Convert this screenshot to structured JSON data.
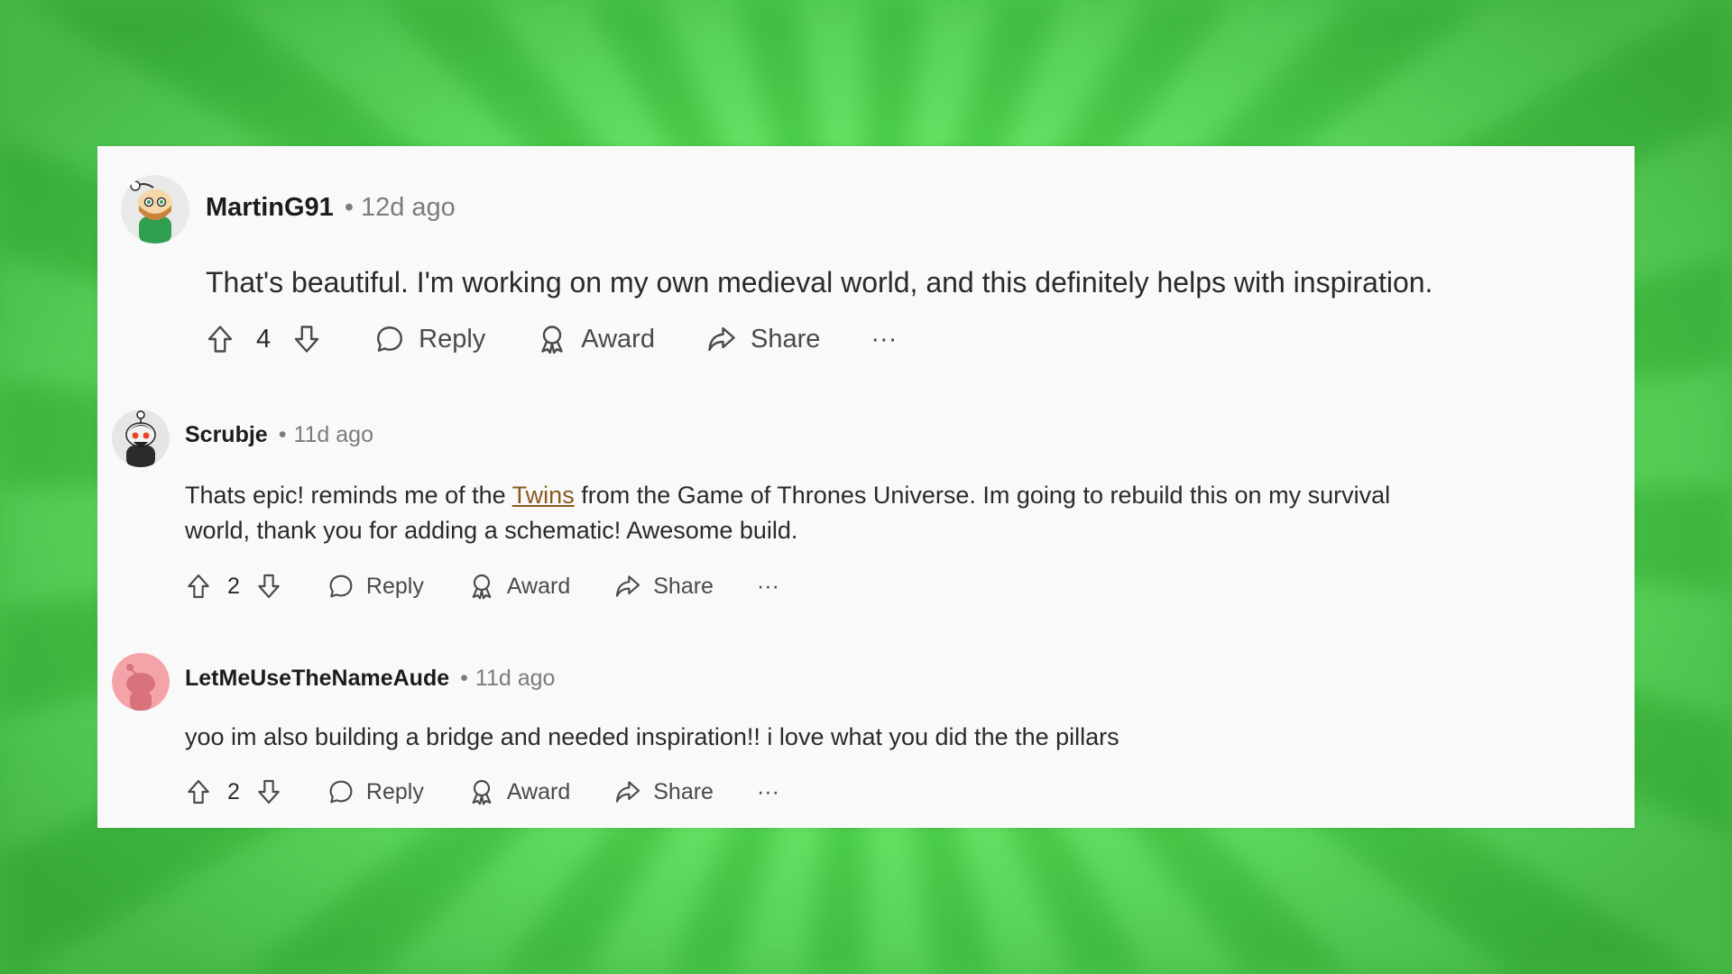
{
  "comments": [
    {
      "username": "MartinG91",
      "separator": "•",
      "time": "12d ago",
      "avatar_icon": "snoo-avatar-green",
      "body": "That's beautiful. I'm working on my own medieval world, and this definitely helps with inspiration.",
      "votes": "4",
      "actions": {
        "reply": "Reply",
        "award": "Award",
        "share": "Share",
        "more": "···"
      }
    },
    {
      "username": "Scrubje",
      "separator": "•",
      "time": "11d ago",
      "avatar_icon": "snoo-avatar-dark",
      "body_before_link": "Thats epic! reminds me of the ",
      "body_link": "Twins",
      "body_after_link": " from the Game of Thrones Universe. Im going to rebuild this on my survival world, thank you for adding a schematic! Awesome build.",
      "votes": "2",
      "actions": {
        "reply": "Reply",
        "award": "Award",
        "share": "Share",
        "more": "···"
      }
    },
    {
      "username": "LetMeUseTheNameAude",
      "separator": "•",
      "time": "11d ago",
      "avatar_icon": "snoo-avatar-default-pink",
      "body": "yoo im also building a bridge and needed inspiration!! i love what you did the the pillars",
      "votes": "2",
      "actions": {
        "reply": "Reply",
        "award": "Award",
        "share": "Share",
        "more": "···"
      }
    }
  ],
  "colors": {
    "background_green": "#6be86b",
    "card": "#f9f9f9",
    "link": "#8a5a1e",
    "avatar_pink": "#f4a3a8"
  }
}
